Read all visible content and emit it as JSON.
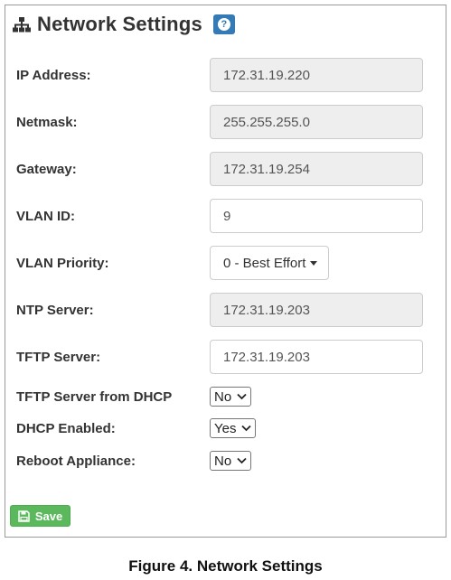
{
  "panel": {
    "title": "Network Settings",
    "help_label": "?"
  },
  "fields": {
    "ip_address": {
      "label": "IP Address:",
      "value": "172.31.19.220"
    },
    "netmask": {
      "label": "Netmask:",
      "value": "255.255.255.0"
    },
    "gateway": {
      "label": "Gateway:",
      "value": "172.31.19.254"
    },
    "vlan_id": {
      "label": "VLAN ID:",
      "value": "9"
    },
    "vlan_priority": {
      "label": "VLAN Priority:",
      "value": "0 - Best Effort"
    },
    "ntp_server": {
      "label": "NTP Server:",
      "value": "172.31.19.203"
    },
    "tftp_server": {
      "label": "TFTP Server:",
      "value": "172.31.19.203"
    },
    "tftp_from_dhcp": {
      "label": "TFTP Server from DHCP",
      "value": "No"
    },
    "dhcp_enabled": {
      "label": "DHCP Enabled:",
      "value": "Yes"
    },
    "reboot_appliance": {
      "label": "Reboot Appliance:",
      "value": "No"
    }
  },
  "actions": {
    "save_label": "Save"
  },
  "caption": "Figure 4. Network Settings",
  "colors": {
    "primary": "#337ab7",
    "success": "#5cb85c",
    "readonly_bg": "#eeeeee"
  }
}
